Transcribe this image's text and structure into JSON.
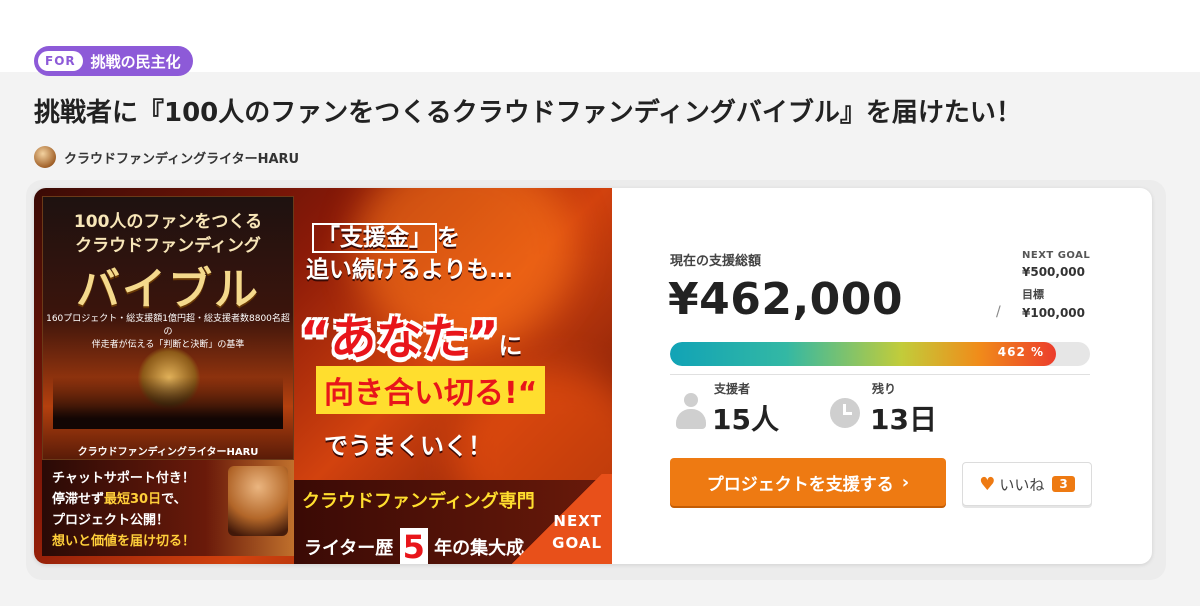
{
  "tag": {
    "for_label": "FOR",
    "category": "挑戦の民主化"
  },
  "project": {
    "title": "挑戦者に『100人のファンをつくるクラウドファンディングバイブル』を届けたい！",
    "author": "クラウドファンディングライターHARU"
  },
  "banner": {
    "book_line1": "100人のファンをつくる",
    "book_line2": "クラウドファンディング",
    "book_line3": "バイブル",
    "book_desc1": "160プロジェクト・総支援額1億円超・総支援者数8800名超の",
    "book_desc2": "伴走者が伝える「判断と決断」の基準",
    "book_author": "クラウドファンディングライターHARU",
    "chat_line1": "チャットサポート付き！",
    "chat_line2a": "停滞せず",
    "chat_line2b": "最短30日",
    "chat_line2c": "で、",
    "chat_line3": "プロジェクト公開！",
    "chat_line4": "想いと価値を届け切る！",
    "catch1_box": "「支援金」",
    "catch1_rest": "を",
    "catch2": "追い続けるよりも…",
    "catch3": "“あなた”",
    "catch3_ni": "に",
    "catch4": "向き合い切る!“",
    "catch5": "でうまくいく！",
    "band1": "クラウドファンディング専門",
    "band2a": "ライター歴",
    "band2b": "5",
    "band2c": "年の集大成",
    "next_goal_line1": "NEXT",
    "next_goal_line2": "GOAL"
  },
  "stats": {
    "total_label": "現在の支援総額",
    "total_amount": "¥462,000",
    "next_goal_label": "NEXT GOAL",
    "next_goal_amount": "¥500,000",
    "goal_label": "目標",
    "goal_amount": "¥100,000",
    "slash": "/",
    "progress_percent": 462,
    "progress_text": "462 %",
    "backers_label": "支援者",
    "backers_value": "15人",
    "remaining_label": "残り",
    "remaining_value": "13日"
  },
  "actions": {
    "support_label": "プロジェクトを支援する",
    "support_chevron": "›",
    "like_label": "いいね",
    "like_count": "3",
    "heart_glyph": "♥"
  },
  "colors": {
    "accent": "#ee7a12",
    "tag_purple": "#8d5ad8"
  }
}
